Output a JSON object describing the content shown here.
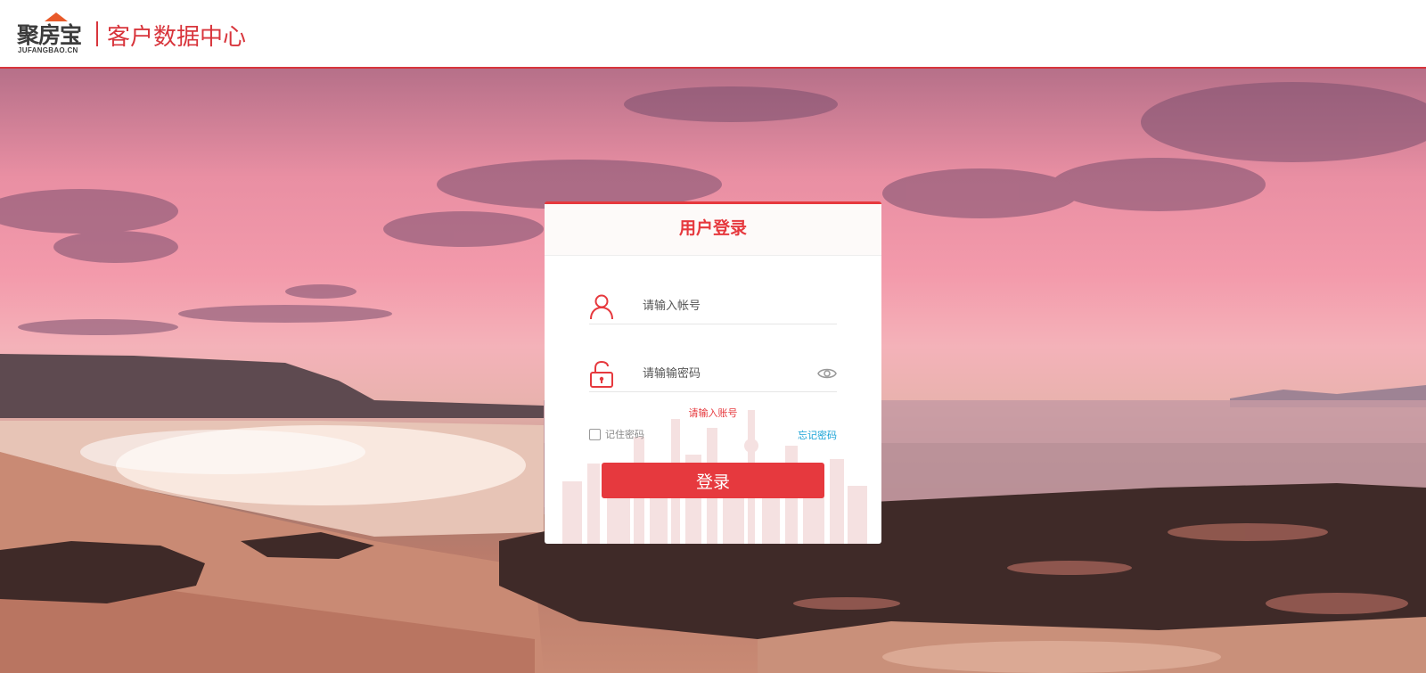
{
  "header": {
    "logo_cn": "聚房宝",
    "logo_en": "JUFANGBAO.CN",
    "title": "客户数据中心"
  },
  "login": {
    "title": "用户登录",
    "account_placeholder": "请输入帐号",
    "password_placeholder": "请输输密码",
    "error_text": "请输入账号",
    "remember_label": "记住密码",
    "forgot_label": "忘记密码",
    "submit_label": "登录"
  },
  "colors": {
    "accent": "#e6393e",
    "link": "#1aa3d6"
  },
  "icons": {
    "account": "user-icon",
    "password": "lock-icon",
    "show_password": "eye-icon"
  }
}
